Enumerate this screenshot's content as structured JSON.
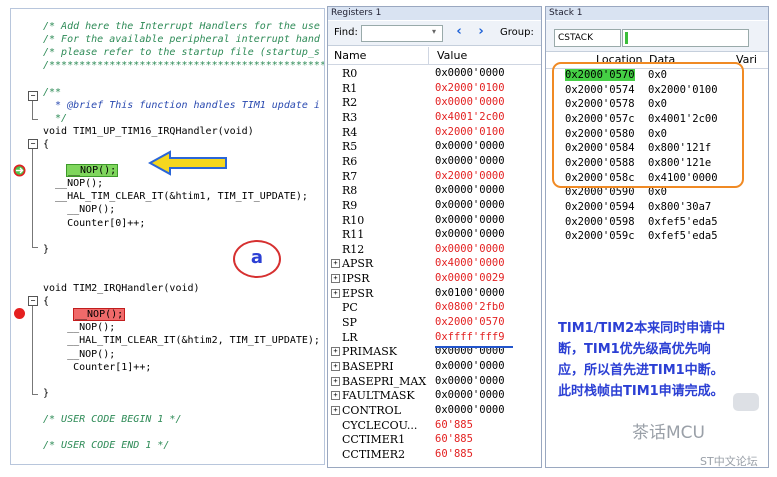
{
  "editor": {
    "lines": [
      {
        "type": "comment",
        "text": "/* Add here the Interrupt Handlers for the use"
      },
      {
        "type": "comment",
        "text": "/* For the available peripheral interrupt hand"
      },
      {
        "type": "comment",
        "text": "/* please refer to the startup file (startup_s"
      },
      {
        "type": "comment",
        "text": "/**************************************************"
      },
      {
        "type": "blank",
        "text": ""
      },
      {
        "type": "comment",
        "text": "/**"
      },
      {
        "type": "comment2",
        "text": "  * @brief This function handles TIM1 update i"
      },
      {
        "type": "comment",
        "text": "  */"
      },
      {
        "type": "code",
        "text": "void TIM1_UP_TIM16_IRQHandler(void)"
      },
      {
        "type": "code",
        "text": "{"
      },
      {
        "type": "blank",
        "text": ""
      },
      {
        "type": "nop_current",
        "text": "__NOP();"
      },
      {
        "type": "code",
        "text": "  __NOP();"
      },
      {
        "type": "code",
        "text": "  __HAL_TIM_CLEAR_IT(&htim1, TIM_IT_UPDATE);"
      },
      {
        "type": "code",
        "text": "    __NOP();"
      },
      {
        "type": "code",
        "text": "    Counter[0]++;"
      },
      {
        "type": "blank",
        "text": ""
      },
      {
        "type": "code",
        "text": "}"
      },
      {
        "type": "blank",
        "text": ""
      },
      {
        "type": "blank",
        "text": ""
      },
      {
        "type": "code",
        "text": "void TIM2_IRQHandler(void)"
      },
      {
        "type": "code",
        "text": "{"
      },
      {
        "type": "nop_bp",
        "text": "__NOP();"
      },
      {
        "type": "code",
        "text": "    __NOP();"
      },
      {
        "type": "code",
        "text": "    __HAL_TIM_CLEAR_IT(&htim2, TIM_IT_UPDATE);"
      },
      {
        "type": "code",
        "text": "    __NOP();"
      },
      {
        "type": "code",
        "text": "     Counter[1]++;"
      },
      {
        "type": "blank",
        "text": ""
      },
      {
        "type": "code",
        "text": "}"
      },
      {
        "type": "blank",
        "text": ""
      },
      {
        "type": "comment",
        "text": "/* USER CODE BEGIN 1 */"
      },
      {
        "type": "blank",
        "text": ""
      },
      {
        "type": "comment",
        "text": "/* USER CODE END 1 */"
      }
    ],
    "annotation_label": "a"
  },
  "registers": {
    "title": "Registers 1",
    "find_label": "Find:",
    "group_label": "Group:",
    "col_name": "Name",
    "col_value": "Value",
    "rows": [
      {
        "name": "R0",
        "value": "0x0000'0000",
        "changed": false,
        "expand": false
      },
      {
        "name": "R1",
        "value": "0x2000'0100",
        "changed": true,
        "expand": false
      },
      {
        "name": "R2",
        "value": "0x0000'0000",
        "changed": true,
        "expand": false
      },
      {
        "name": "R3",
        "value": "0x4001'2c00",
        "changed": true,
        "expand": false
      },
      {
        "name": "R4",
        "value": "0x2000'0100",
        "changed": true,
        "expand": false
      },
      {
        "name": "R5",
        "value": "0x0000'0000",
        "changed": false,
        "expand": false
      },
      {
        "name": "R6",
        "value": "0x0000'0000",
        "changed": false,
        "expand": false
      },
      {
        "name": "R7",
        "value": "0x2000'0000",
        "changed": true,
        "expand": false
      },
      {
        "name": "R8",
        "value": "0x0000'0000",
        "changed": false,
        "expand": false
      },
      {
        "name": "R9",
        "value": "0x0000'0000",
        "changed": false,
        "expand": false
      },
      {
        "name": "R10",
        "value": "0x0000'0000",
        "changed": false,
        "expand": false
      },
      {
        "name": "R11",
        "value": "0x0000'0000",
        "changed": false,
        "expand": false
      },
      {
        "name": "R12",
        "value": "0x0000'0000",
        "changed": true,
        "expand": false
      },
      {
        "name": "APSR",
        "value": "0x4000'0000",
        "changed": true,
        "expand": true
      },
      {
        "name": "IPSR",
        "value": "0x0000'0029",
        "changed": true,
        "expand": true
      },
      {
        "name": "EPSR",
        "value": "0x0100'0000",
        "changed": false,
        "expand": true
      },
      {
        "name": "PC",
        "value": "0x0800'2fb0",
        "changed": true,
        "expand": false
      },
      {
        "name": "SP",
        "value": "0x2000'0570",
        "changed": true,
        "expand": false
      },
      {
        "name": "LR",
        "value": "0xffff'fff9",
        "changed": true,
        "expand": false
      },
      {
        "name": "PRIMASK",
        "value": "0x0000'0000",
        "changed": false,
        "expand": true
      },
      {
        "name": "BASEPRI",
        "value": "0x0000'0000",
        "changed": false,
        "expand": true
      },
      {
        "name": "BASEPRI_MAX",
        "value": "0x0000'0000",
        "changed": false,
        "expand": true
      },
      {
        "name": "FAULTMASK",
        "value": "0x0000'0000",
        "changed": false,
        "expand": true
      },
      {
        "name": "CONTROL",
        "value": "0x0000'0000",
        "changed": false,
        "expand": true
      },
      {
        "name": "CYCLECOU...",
        "value": "60'885",
        "changed": true,
        "expand": false
      },
      {
        "name": "CCTIMER1",
        "value": "60'885",
        "changed": true,
        "expand": false
      },
      {
        "name": "CCTIMER2",
        "value": "60'885",
        "changed": true,
        "expand": false
      }
    ]
  },
  "stack": {
    "title": "Stack 1",
    "select_value": "CSTACK",
    "col_location": "Location",
    "col_data": "Data",
    "col_variable": "Vari",
    "rows": [
      {
        "location": "0x2000'0570",
        "data": "0x0",
        "current": true
      },
      {
        "location": "0x2000'0574",
        "data": "0x2000'0100",
        "current": false
      },
      {
        "location": "0x2000'0578",
        "data": "0x0",
        "current": false
      },
      {
        "location": "0x2000'057c",
        "data": "0x4001'2c00",
        "current": false
      },
      {
        "location": "0x2000'0580",
        "data": "0x0",
        "current": false
      },
      {
        "location": "0x2000'0584",
        "data": "0x800'121f",
        "current": false
      },
      {
        "location": "0x2000'0588",
        "data": "0x800'121e",
        "current": false
      },
      {
        "location": "0x2000'058c",
        "data": "0x4100'0000",
        "current": false
      },
      {
        "location": "0x2000'0590",
        "data": "0x0",
        "current": false
      },
      {
        "location": "0x2000'0594",
        "data": "0x800'30a7",
        "current": false
      },
      {
        "location": "0x2000'0598",
        "data": "0xfef5'eda5",
        "current": false
      },
      {
        "location": "0x2000'059c",
        "data": "0xfef5'eda5",
        "current": false
      }
    ]
  },
  "note": {
    "lines": [
      "TIM1/TIM2本来同时申请中",
      "断，TIM1优先级高优先响",
      "应，所以首先进TIM1中断。",
      "此时栈帧由TIM1申请完成。"
    ]
  },
  "watermark": {
    "text": "茶话MCU",
    "sub": "ST中文论坛"
  }
}
